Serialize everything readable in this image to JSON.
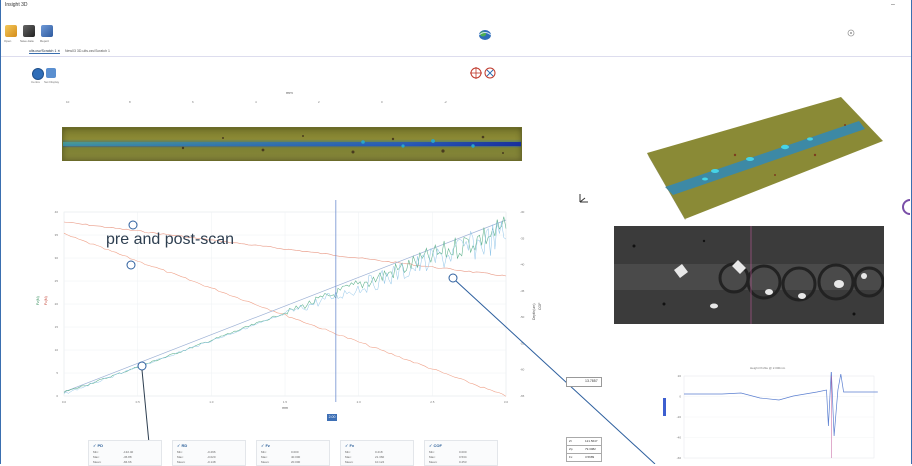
{
  "window": {
    "title": "Insight 3D"
  },
  "toolbar": {
    "buttons": [
      {
        "name": "open-button",
        "label": "Open",
        "color": "#e4a72c"
      },
      {
        "name": "save-button",
        "label": "Save data",
        "color": "#333333"
      },
      {
        "name": "report-button",
        "label": "Report",
        "color": "#3b6bb0"
      }
    ]
  },
  "tabs": [
    {
      "label": "ults.csv/Scratch 1 ✕"
    },
    {
      "label": "New03 3D-ults.csv/Scratch 1"
    }
  ],
  "subtoolbar": [
    {
      "label": "Centre"
    },
    {
      "label": "Set Display"
    }
  ],
  "top_axis": {
    "unit": "mm",
    "ticks": [
      "10",
      "8",
      "6",
      "4",
      "2",
      "0",
      "-2"
    ]
  },
  "main_chart": {
    "x_unit": "mm",
    "x_ticks": [
      "0.0",
      "0.5",
      "1.0",
      "1.5",
      "2.0",
      "2.5",
      "3.0"
    ],
    "y_left_ticks": [
      "40",
      "35",
      "30",
      "25",
      "20",
      "15",
      "10",
      "5",
      "0"
    ],
    "y_right_ticks": [
      "-30",
      "-35",
      "-40",
      "-45",
      "-50",
      "-55",
      "-60",
      "-65"
    ],
    "y_left_label": "Fz(N)",
    "y_left2_label": "Fx(N)",
    "y_right_label": "COF",
    "y_right2_label": "Depth(um)",
    "cursor_value": "2.00"
  },
  "annotation": {
    "text": "pre and post-scan"
  },
  "stats": [
    {
      "title": "✓ PD",
      "rows": [
        [
          "Min:",
          "-132.40"
        ],
        [
          "Max:",
          "-36.88"
        ],
        [
          "Mean:",
          "-84.66"
        ]
      ]
    },
    {
      "title": "✓ RD",
      "rows": [
        [
          "Min:",
          "-0.296"
        ],
        [
          "Max:",
          "-0.020"
        ],
        [
          "Mean:",
          "-0.148"
        ]
      ]
    },
    {
      "title": "✓ Fz",
      "rows": [
        [
          "Min:",
          "0.000"
        ],
        [
          "Max:",
          "40.000"
        ],
        [
          "Mean:",
          "20.000"
        ]
      ]
    },
    {
      "title": "✓ Fx",
      "rows": [
        [
          "Min:",
          "0.218"
        ],
        [
          "Max:",
          "21.360"
        ],
        [
          "Mean:",
          "10.124"
        ]
      ]
    },
    {
      "title": "✓ COF",
      "rows": [
        [
          "Min:",
          "0.000"
        ],
        [
          "Max:",
          "0.534"
        ],
        [
          "Mean:",
          "0.253"
        ]
      ]
    }
  ],
  "readouts": {
    "value": "13.7857",
    "dims": [
      {
        "k": "Zr",
        "v": "121.5647"
      },
      {
        "k": "Zp",
        "v": "79.3082"
      },
      {
        "k": "Fx",
        "v": "3.5689"
      }
    ]
  },
  "profile": {
    "title": "Height Profile @ 2.000mm",
    "y_ticks": [
      "20",
      "0",
      "-20",
      "-40",
      "-60"
    ]
  }
}
